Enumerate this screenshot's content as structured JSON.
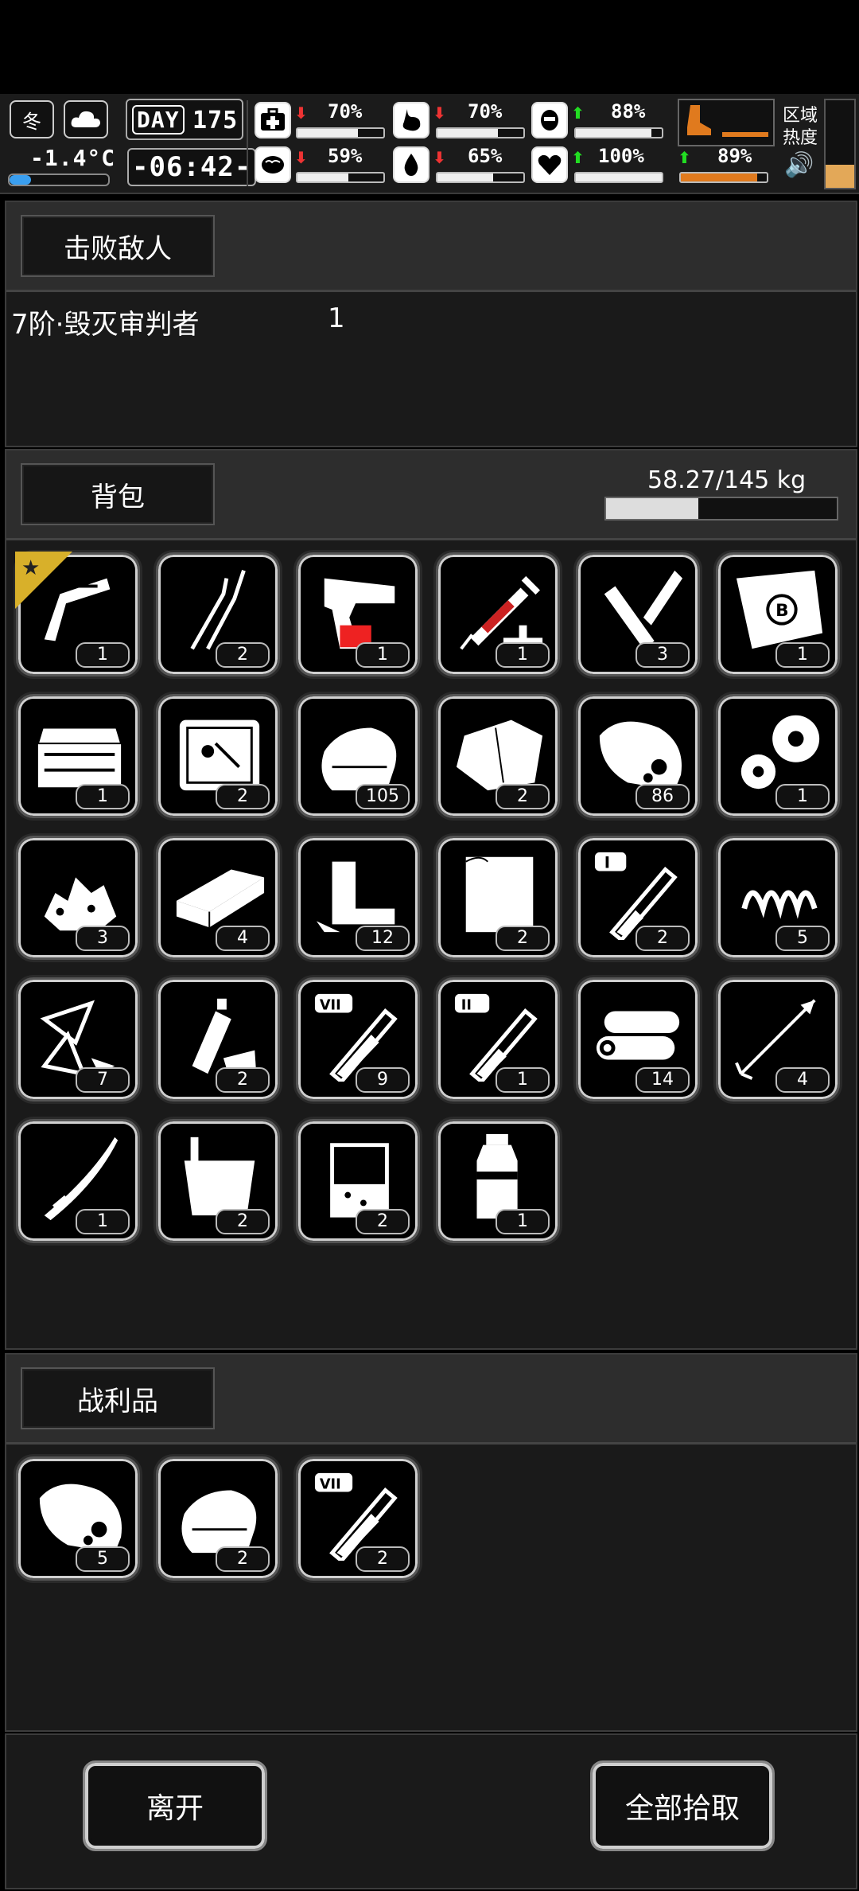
{
  "hud": {
    "season": "冬",
    "temperature": "-1.4°C",
    "day_label": "DAY",
    "day_number": "175",
    "time": "-06:42-",
    "stats": [
      {
        "name": "health",
        "icon": "medkit-icon",
        "trend": "down",
        "value": "70%",
        "level": 0.7
      },
      {
        "name": "hunger",
        "icon": "stomach-icon",
        "trend": "down",
        "value": "70%",
        "level": 0.7
      },
      {
        "name": "fatigue",
        "icon": "helmet-icon",
        "trend": "up",
        "value": "88%",
        "level": 0.88
      },
      {
        "name": "sanity",
        "icon": "brain-icon",
        "trend": "down",
        "value": "59%",
        "level": 0.59
      },
      {
        "name": "thirst",
        "icon": "water-drop-icon",
        "trend": "down",
        "value": "65%",
        "level": 0.65
      },
      {
        "name": "mood",
        "icon": "heart-icon",
        "trend": "up",
        "value": "100%",
        "level": 1.0
      },
      {
        "name": "stamina",
        "icon": "boot-icon",
        "trend": "up",
        "value": "89%",
        "level": 0.89
      }
    ],
    "zone_heat_label": "区域热度"
  },
  "defeated": {
    "header": "击败敌人",
    "enemies": [
      {
        "name": "7阶·毁灭审判者",
        "count": "1"
      }
    ]
  },
  "backpack": {
    "header": "背包",
    "weight": "58.27/145 kg",
    "weight_level": 0.4,
    "items": [
      {
        "icon": "caliper-icon",
        "count": "1",
        "starred": true
      },
      {
        "icon": "pliers-icon",
        "count": "2"
      },
      {
        "icon": "flare-gun-icon",
        "count": "1"
      },
      {
        "icon": "syringe-icon",
        "count": "1"
      },
      {
        "icon": "scrolls-icon",
        "count": "3"
      },
      {
        "icon": "blueprint-scroll-icon",
        "count": "1"
      },
      {
        "icon": "toolbox-icon",
        "count": "1"
      },
      {
        "icon": "tool-case-icon",
        "count": "2"
      },
      {
        "icon": "cloth-icon",
        "count": "105"
      },
      {
        "icon": "fabric-sheet-icon",
        "count": "2"
      },
      {
        "icon": "meat-icon",
        "count": "86"
      },
      {
        "icon": "gears-icon",
        "count": "1"
      },
      {
        "icon": "rubble-icon",
        "count": "3"
      },
      {
        "icon": "brick-icon",
        "count": "4"
      },
      {
        "icon": "scrap-metal-icon",
        "count": "12"
      },
      {
        "icon": "paper-icon",
        "count": "2"
      },
      {
        "icon": "test-tube-i-icon",
        "count": "2"
      },
      {
        "icon": "spring-icon",
        "count": "5"
      },
      {
        "icon": "glass-shards-icon",
        "count": "7"
      },
      {
        "icon": "plastic-bottles-icon",
        "count": "2"
      },
      {
        "icon": "test-tube-vii-icon",
        "count": "9"
      },
      {
        "icon": "test-tube-ii-icon",
        "count": "1"
      },
      {
        "icon": "logs-icon",
        "count": "14"
      },
      {
        "icon": "arrow-icon",
        "count": "4"
      },
      {
        "icon": "katana-icon",
        "count": "1"
      },
      {
        "icon": "bucket-icon",
        "count": "2"
      },
      {
        "icon": "beaker-icon",
        "count": "2"
      },
      {
        "icon": "water-bottle-icon",
        "count": "1"
      }
    ]
  },
  "loot": {
    "header": "战利品",
    "items": [
      {
        "icon": "meat-icon",
        "count": "5"
      },
      {
        "icon": "cloth-icon",
        "count": "2"
      },
      {
        "icon": "test-tube-vii-icon",
        "count": "2"
      }
    ]
  },
  "actions": {
    "leave": "离开",
    "take_all": "全部拾取"
  }
}
